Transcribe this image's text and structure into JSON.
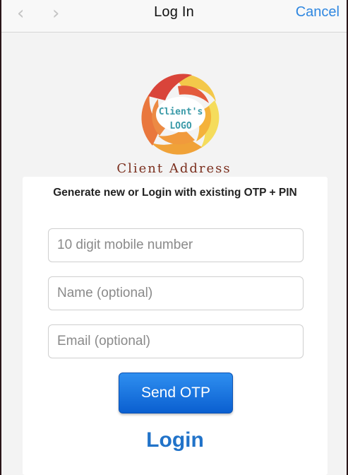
{
  "navbar": {
    "back_glyph": "‹",
    "forward_glyph": "›",
    "title": "Log In",
    "cancel_label": "Cancel"
  },
  "logo": {
    "line1": "Client's",
    "line2": "LOGO",
    "colors": [
      "#e0503a",
      "#f0a238",
      "#f5d64a",
      "#e98f4e"
    ],
    "text_color": "#3a9aa8"
  },
  "client_address": "Client Address",
  "form": {
    "instructions": "Generate new or Login with existing OTP + PIN",
    "mobile_placeholder": "10 digit mobile number",
    "name_placeholder": "Name (optional)",
    "email_placeholder": "Email (optional)",
    "send_otp_label": "Send OTP",
    "login_label": "Login"
  },
  "colors": {
    "accent": "#2f87e0",
    "button": "#1a6fe0",
    "link": "#2173c9"
  }
}
